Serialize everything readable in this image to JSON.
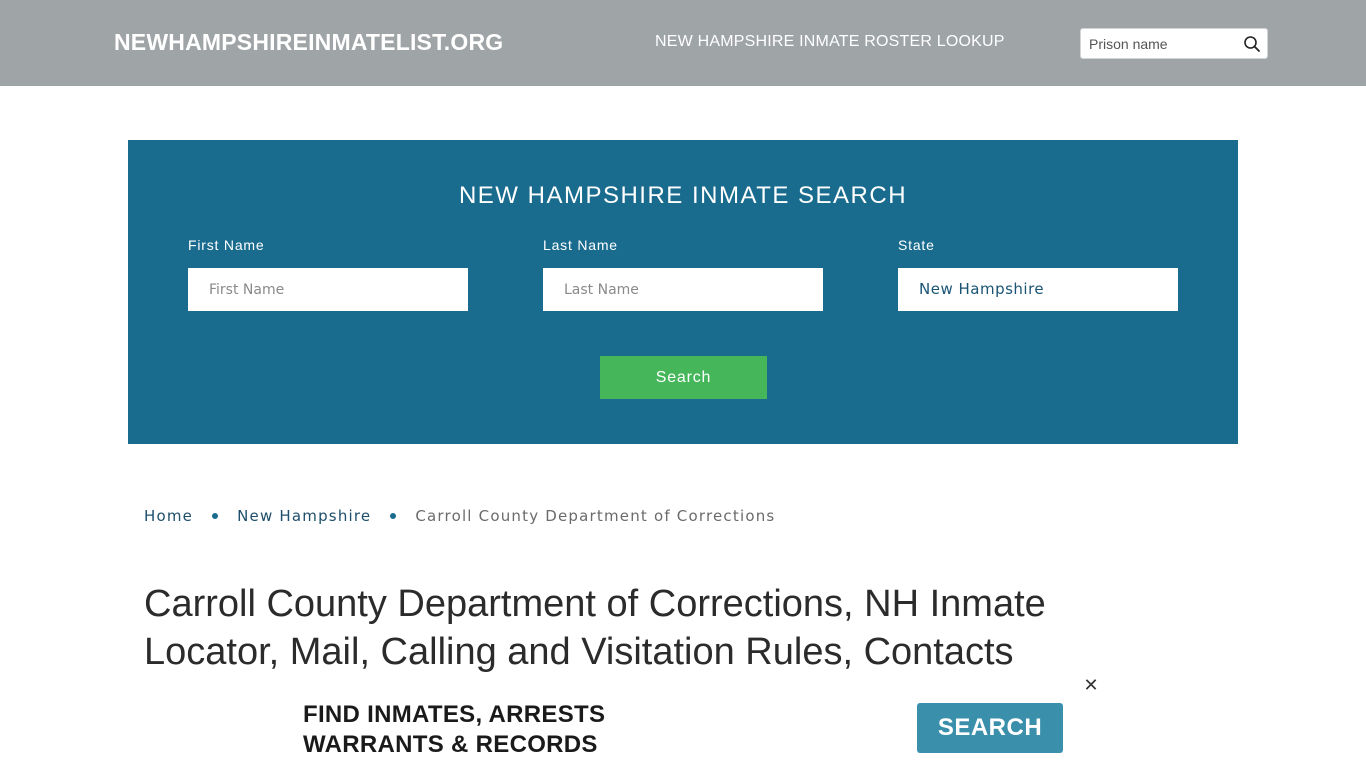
{
  "header": {
    "logo": "NEWHAMPSHIREINMATELIST.ORG",
    "nav_link": "NEW HAMPSHIRE INMATE ROSTER LOOKUP",
    "search": {
      "placeholder": "Prison name",
      "icon": "search-icon"
    }
  },
  "search_panel": {
    "title": "NEW HAMPSHIRE INMATE SEARCH",
    "first_name": {
      "label": "First Name",
      "placeholder": "First Name"
    },
    "last_name": {
      "label": "Last Name",
      "placeholder": "Last Name"
    },
    "state": {
      "label": "State",
      "value": "New Hampshire"
    },
    "button": "Search",
    "colors": {
      "panel": "#1a6c8f",
      "button": "#45b75a"
    }
  },
  "breadcrumb": {
    "items": [
      "Home",
      "New Hampshire"
    ],
    "current": "Carroll County Department of Corrections"
  },
  "main": {
    "title": "Carroll County Department of Corrections, NH Inmate Locator, Mail, Calling and Visitation Rules, Contacts"
  },
  "ad": {
    "line1": "FIND INMATES, ARRESTS",
    "line2": "WARRANTS & RECORDS",
    "button": "SEARCH",
    "close": "✕"
  }
}
